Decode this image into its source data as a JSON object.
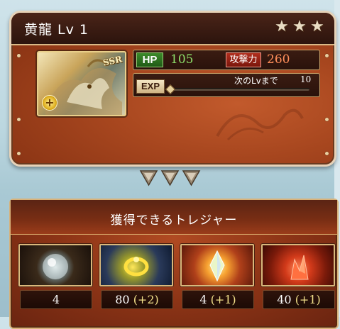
{
  "summon": {
    "title": "黄龍 Lv 1",
    "stars": 3,
    "rarity": "SSR",
    "hp_label": "HP",
    "hp_value": "105",
    "atk_label": "攻撃力",
    "atk_value": "260",
    "exp_label": "EXP",
    "next_level_label": "次のLvまで",
    "next_level_value": "10",
    "exp_progress": 0.0
  },
  "treasure": {
    "title": "獲得できるトレジャー",
    "items": [
      {
        "icon": "silver-orb-icon",
        "count": "4",
        "bonus": ""
      },
      {
        "icon": "gold-ring-icon",
        "count": "80",
        "bonus": "(+2)"
      },
      {
        "icon": "crystal-icon",
        "count": "4",
        "bonus": "(+1)"
      },
      {
        "icon": "fire-gem-icon",
        "count": "40",
        "bonus": "(+1)"
      }
    ]
  }
}
